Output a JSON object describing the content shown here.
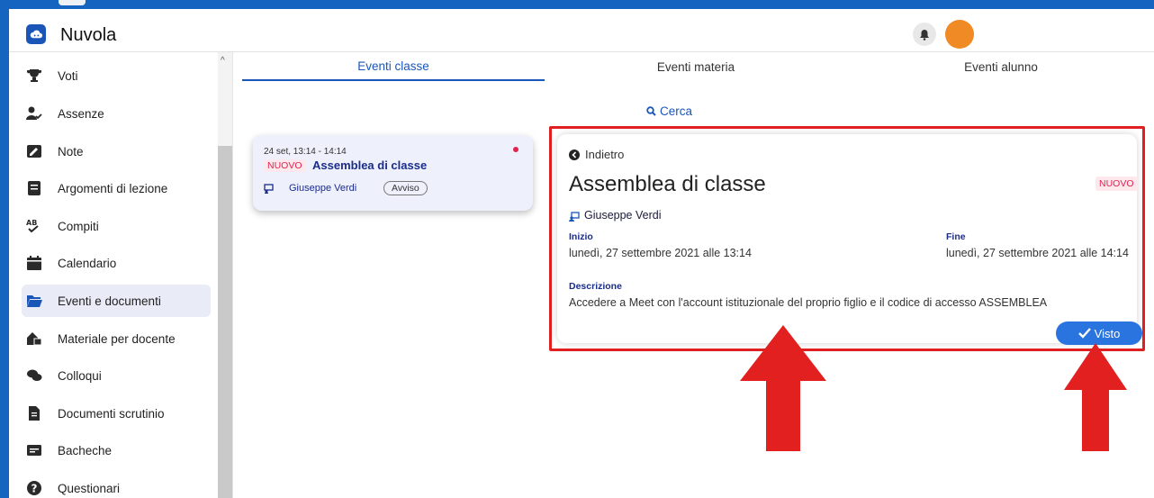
{
  "app": {
    "title": "Nuvola"
  },
  "colors": {
    "accent": "#1a56b8",
    "badge_new": "#e0234f",
    "highlight": "#e02020",
    "avatar": "#f08a24"
  },
  "sidebar": {
    "items": [
      {
        "label": "Voti",
        "icon": "trophy-icon"
      },
      {
        "label": "Assenze",
        "icon": "user-check-icon"
      },
      {
        "label": "Note",
        "icon": "note-icon"
      },
      {
        "label": "Argomenti di lezione",
        "icon": "book-icon"
      },
      {
        "label": "Compiti",
        "icon": "ab-check-icon"
      },
      {
        "label": "Calendario",
        "icon": "calendar-icon"
      },
      {
        "label": "Eventi e documenti",
        "icon": "folder-open-icon",
        "active": true
      },
      {
        "label": "Materiale per docente",
        "icon": "house-share-icon"
      },
      {
        "label": "Colloqui",
        "icon": "chat-bubbles-icon"
      },
      {
        "label": "Documenti scrutinio",
        "icon": "document-icon"
      },
      {
        "label": "Bacheche",
        "icon": "board-icon"
      },
      {
        "label": "Questionari",
        "icon": "question-circle-icon"
      }
    ]
  },
  "tabs": [
    {
      "label": "Eventi classe",
      "active": true
    },
    {
      "label": "Eventi materia"
    },
    {
      "label": "Eventi alunno"
    }
  ],
  "search": {
    "label": "Cerca"
  },
  "event_card": {
    "time": "24 set, 13:14 - 14:14",
    "badge": "NUOVO",
    "title": "Assemblea di classe",
    "person": "Giuseppe Verdi",
    "type": "Avviso"
  },
  "detail": {
    "back_label": "Indietro",
    "title": "Assemblea di classe",
    "badge": "NUOVO",
    "person": "Giuseppe Verdi",
    "start_label": "Inizio",
    "start_value": "lunedì, 27 settembre 2021 alle 13:14",
    "end_label": "Fine",
    "end_value": "lunedì, 27 settembre 2021 alle 14:14",
    "description_label": "Descrizione",
    "description": "Accedere a Meet con l'account istituzionale del proprio figlio e il codice di accesso ASSEMBLEA",
    "seen_button": "Visto"
  }
}
